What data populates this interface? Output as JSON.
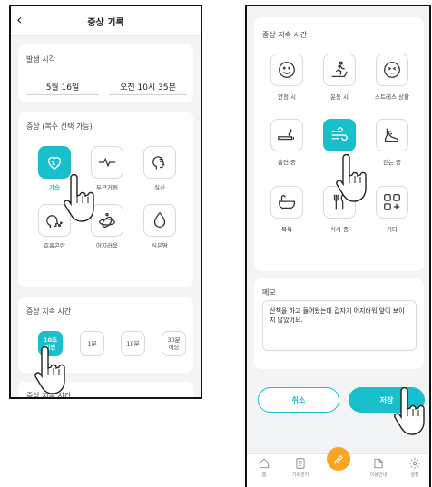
{
  "header": {
    "title": "증상 기록",
    "back_icon": "chevron-left-icon"
  },
  "onset": {
    "label": "발생 시각",
    "date": "5월 16일",
    "time": "오전 10시 35분"
  },
  "symptoms": {
    "label": "증상 (복수 선택 가능)",
    "items": [
      {
        "label": "가슴",
        "icon": "heart-pain-icon",
        "selected": true
      },
      {
        "label": "두근거림",
        "icon": "heartbeat-icon",
        "selected": false
      },
      {
        "label": "실신",
        "icon": "head-faint-icon",
        "selected": false
      },
      {
        "label": "호흡곤란",
        "icon": "head-breath-icon",
        "selected": false
      },
      {
        "label": "어지러움",
        "icon": "dizzy-icon",
        "selected": false
      },
      {
        "label": "식은땀",
        "icon": "sweat-drop-icon",
        "selected": false
      }
    ]
  },
  "duration": {
    "label": "증상 지속 시간",
    "options": [
      {
        "label": "10초\n미만",
        "selected": true
      },
      {
        "label": "1분",
        "selected": false
      },
      {
        "label": "10분",
        "selected": false
      },
      {
        "label": "30분\n이상",
        "selected": false
      }
    ],
    "next_label_partial": "증상 지속 시간"
  },
  "situation": {
    "label": "증상 지속 시간",
    "items": [
      {
        "label": "안정 시",
        "icon": "smile-face-icon",
        "selected": false
      },
      {
        "label": "운동 시",
        "icon": "treadmill-icon",
        "selected": false
      },
      {
        "label": "스트레스 상황",
        "icon": "stress-face-icon",
        "selected": false
      },
      {
        "label": "흡연 중",
        "icon": "cigarette-icon",
        "selected": false
      },
      {
        "label": "",
        "icon": "wind-icon",
        "selected": true
      },
      {
        "label": "걷는 중",
        "icon": "walking-shoe-icon",
        "selected": false
      },
      {
        "label": "목욕",
        "icon": "bathtub-icon",
        "selected": false
      },
      {
        "label": "식사 중",
        "icon": "utensils-icon",
        "selected": false
      },
      {
        "label": "기타",
        "icon": "grid-plus-icon",
        "selected": false
      }
    ]
  },
  "memo": {
    "label": "메모",
    "text": "산책을 하고 들어왔는데 갑자기 어지러워 앞이 보이지 않았어요."
  },
  "actions": {
    "cancel": "취소",
    "save": "저장"
  },
  "tabbar": {
    "items": [
      {
        "label": "홈",
        "icon": "home-icon"
      },
      {
        "label": "기록관리",
        "icon": "document-icon"
      },
      {
        "label": "",
        "icon": "pencil-icon"
      },
      {
        "label": "이용안내",
        "icon": "guide-icon"
      },
      {
        "label": "설정",
        "icon": "gear-icon"
      }
    ]
  },
  "colors": {
    "accent": "#19bfcc",
    "tab_center": "#f6a623",
    "background": "#f3f4f6"
  }
}
